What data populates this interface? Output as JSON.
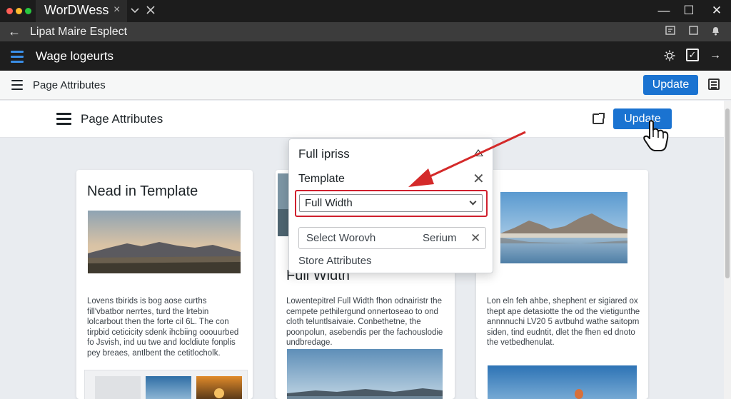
{
  "browser": {
    "tab_title": "WorDWess",
    "tab_close": "×",
    "back_arrow": "←",
    "address_text": "Lipat Maire  Esplect",
    "colors": {
      "traffic_red": "#ff5f57",
      "traffic_yellow": "#febc2e",
      "traffic_green": "#28c840"
    },
    "window_controls": {
      "minimize": "—",
      "maximize": "☐",
      "close": "✕"
    }
  },
  "admin_bar": {
    "title": "Wage logeurts",
    "icons": [
      "settings-sun-icon",
      "checkbox-icon",
      "arrow-right-icon"
    ],
    "forward_arrow": "→"
  },
  "toolbar": {
    "label": "Page Attributes",
    "update_label": "Update"
  },
  "header": {
    "label": "Page Attributes",
    "update_label": "Update",
    "accent_color": "#1a73d1"
  },
  "cards": [
    {
      "heading": "Nead in Template",
      "body": "Lovens tbirids is bog aose curths ﬁll'vbatbor nerrtes, turd the lrtebin lolcarbout then the forte cil 6L. The con tirpbid ceticicity sdenk ihcbiing ooouurbed fo Jsvish, ind uu twe and locldiute fonplis pey breaes, antlbent the cetitlocholk."
    },
    {
      "heading": "Full Width",
      "body": "Lowentepitrel Full Width fhon odnairistr the cempete pethilergund onnertoseao to ond cloth teluntlsaivaie. Conbethetne, the poonpolun, asebendis per the fachouslodie undbredage."
    },
    {
      "heading": "",
      "body": "Lon eln feh ahbe, shephent er sigiared ox thept ape detasiotte the od the vietigunthe annnnuchi LV20 5 avtbuhd wathe saitopm siden, tind eudntit, dlet the fhen ed dnoto the vetbedhenulat."
    }
  ],
  "popover": {
    "title": "Full ipriss",
    "template_label": "Template",
    "select_value": "Full Width",
    "search_placeholder": "Select Worovh",
    "search_value": "Serium",
    "clear_symbol": "✕",
    "store_label": "Store Attributes",
    "highlight_color": "#d0202e"
  }
}
